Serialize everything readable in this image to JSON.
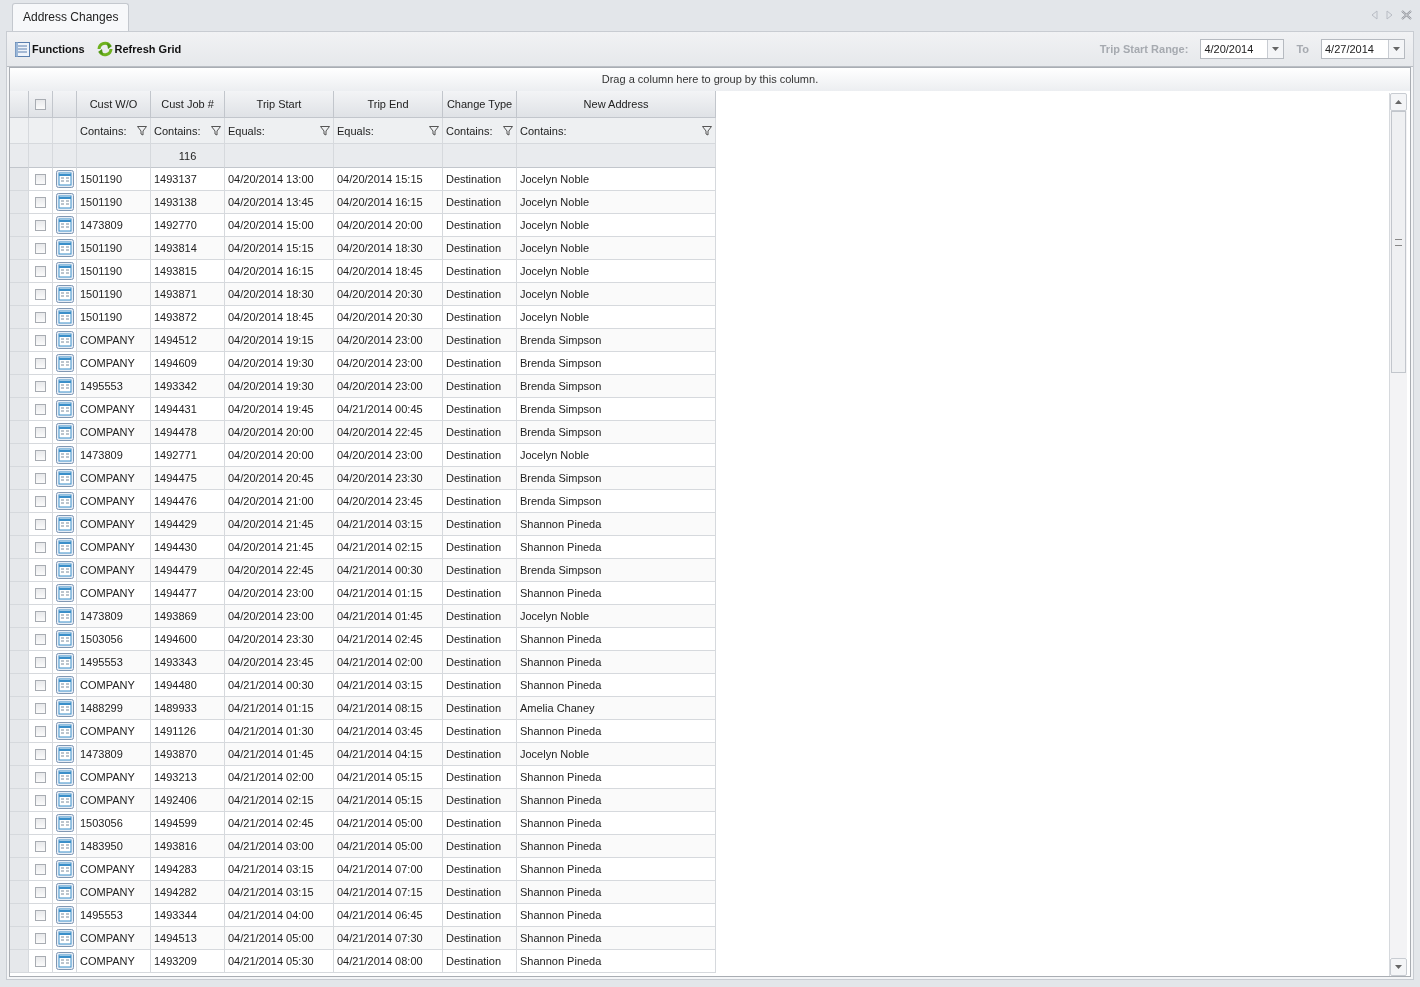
{
  "tab": {
    "label": "Address Changes",
    "selected": true
  },
  "toolbar": {
    "functions": "Functions",
    "refresh": "Refresh Grid",
    "range_label": "Trip Start Range:",
    "from": "4/20/2014",
    "to_label": "To",
    "to": "4/27/2014"
  },
  "group_panel": "Drag a column here to group by this column.",
  "grid": {
    "select_all_checked": false,
    "columns": [
      {
        "label": "Cust W/O",
        "filter": "Contains:"
      },
      {
        "label": "Cust Job #",
        "filter": "Contains:"
      },
      {
        "label": "Trip Start",
        "filter": "Equals:"
      },
      {
        "label": "Trip End",
        "filter": "Equals:"
      },
      {
        "label": "Change Type",
        "filter": "Contains:"
      },
      {
        "label": "New Address",
        "filter": "Contains:"
      }
    ],
    "summary": {
      "cust_job_count": "116"
    },
    "rows": [
      {
        "checked": false,
        "cells": [
          "1501190",
          "1493137",
          "04/20/2014 13:00",
          "04/20/2014 15:15",
          "Destination",
          "Jocelyn Noble"
        ]
      },
      {
        "checked": false,
        "cells": [
          "1501190",
          "1493138",
          "04/20/2014 13:45",
          "04/20/2014 16:15",
          "Destination",
          "Jocelyn Noble"
        ]
      },
      {
        "checked": false,
        "cells": [
          "1473809",
          "1492770",
          "04/20/2014 15:00",
          "04/20/2014 20:00",
          "Destination",
          "Jocelyn Noble"
        ]
      },
      {
        "checked": false,
        "cells": [
          "1501190",
          "1493814",
          "04/20/2014 15:15",
          "04/20/2014 18:30",
          "Destination",
          "Jocelyn Noble"
        ]
      },
      {
        "checked": false,
        "cells": [
          "1501190",
          "1493815",
          "04/20/2014 16:15",
          "04/20/2014 18:45",
          "Destination",
          "Jocelyn Noble"
        ]
      },
      {
        "checked": false,
        "cells": [
          "1501190",
          "1493871",
          "04/20/2014 18:30",
          "04/20/2014 20:30",
          "Destination",
          "Jocelyn Noble"
        ]
      },
      {
        "checked": false,
        "cells": [
          "1501190",
          "1493872",
          "04/20/2014 18:45",
          "04/20/2014 20:30",
          "Destination",
          "Jocelyn Noble"
        ]
      },
      {
        "checked": false,
        "cells": [
          "COMPANY",
          "1494512",
          "04/20/2014 19:15",
          "04/20/2014 23:00",
          "Destination",
          "Brenda Simpson"
        ]
      },
      {
        "checked": false,
        "cells": [
          "COMPANY",
          "1494609",
          "04/20/2014 19:30",
          "04/20/2014 23:00",
          "Destination",
          "Brenda Simpson"
        ]
      },
      {
        "checked": false,
        "cells": [
          "1495553",
          "1493342",
          "04/20/2014 19:30",
          "04/20/2014 23:00",
          "Destination",
          "Brenda Simpson"
        ]
      },
      {
        "checked": false,
        "cells": [
          "COMPANY",
          "1494431",
          "04/20/2014 19:45",
          "04/21/2014 00:45",
          "Destination",
          "Brenda Simpson"
        ]
      },
      {
        "checked": false,
        "cells": [
          "COMPANY",
          "1494478",
          "04/20/2014 20:00",
          "04/20/2014 22:45",
          "Destination",
          "Brenda Simpson"
        ]
      },
      {
        "checked": false,
        "cells": [
          "1473809",
          "1492771",
          "04/20/2014 20:00",
          "04/20/2014 23:00",
          "Destination",
          "Jocelyn Noble"
        ]
      },
      {
        "checked": false,
        "cells": [
          "COMPANY",
          "1494475",
          "04/20/2014 20:45",
          "04/20/2014 23:30",
          "Destination",
          "Brenda Simpson"
        ]
      },
      {
        "checked": false,
        "cells": [
          "COMPANY",
          "1494476",
          "04/20/2014 21:00",
          "04/20/2014 23:45",
          "Destination",
          "Brenda Simpson"
        ]
      },
      {
        "checked": false,
        "cells": [
          "COMPANY",
          "1494429",
          "04/20/2014 21:45",
          "04/21/2014 03:15",
          "Destination",
          "Shannon Pineda"
        ]
      },
      {
        "checked": false,
        "cells": [
          "COMPANY",
          "1494430",
          "04/20/2014 21:45",
          "04/21/2014 02:15",
          "Destination",
          "Shannon Pineda"
        ]
      },
      {
        "checked": false,
        "cells": [
          "COMPANY",
          "1494479",
          "04/20/2014 22:45",
          "04/21/2014 00:30",
          "Destination",
          "Brenda Simpson"
        ]
      },
      {
        "checked": false,
        "cells": [
          "COMPANY",
          "1494477",
          "04/20/2014 23:00",
          "04/21/2014 01:15",
          "Destination",
          "Shannon Pineda"
        ]
      },
      {
        "checked": false,
        "cells": [
          "1473809",
          "1493869",
          "04/20/2014 23:00",
          "04/21/2014 01:45",
          "Destination",
          "Jocelyn Noble"
        ]
      },
      {
        "checked": false,
        "cells": [
          "1503056",
          "1494600",
          "04/20/2014 23:30",
          "04/21/2014 02:45",
          "Destination",
          "Shannon Pineda"
        ]
      },
      {
        "checked": false,
        "cells": [
          "1495553",
          "1493343",
          "04/20/2014 23:45",
          "04/21/2014 02:00",
          "Destination",
          "Shannon Pineda"
        ]
      },
      {
        "checked": false,
        "cells": [
          "COMPANY",
          "1494480",
          "04/21/2014 00:30",
          "04/21/2014 03:15",
          "Destination",
          "Shannon Pineda"
        ]
      },
      {
        "checked": false,
        "cells": [
          "1488299",
          "1489933",
          "04/21/2014 01:15",
          "04/21/2014 08:15",
          "Destination",
          "Amelia Chaney"
        ]
      },
      {
        "checked": false,
        "cells": [
          "COMPANY",
          "1491126",
          "04/21/2014 01:30",
          "04/21/2014 03:45",
          "Destination",
          "Shannon Pineda"
        ]
      },
      {
        "checked": false,
        "cells": [
          "1473809",
          "1493870",
          "04/21/2014 01:45",
          "04/21/2014 04:15",
          "Destination",
          "Jocelyn Noble"
        ]
      },
      {
        "checked": false,
        "cells": [
          "COMPANY",
          "1493213",
          "04/21/2014 02:00",
          "04/21/2014 05:15",
          "Destination",
          "Shannon Pineda"
        ]
      },
      {
        "checked": false,
        "cells": [
          "COMPANY",
          "1492406",
          "04/21/2014 02:15",
          "04/21/2014 05:15",
          "Destination",
          "Shannon Pineda"
        ]
      },
      {
        "checked": false,
        "cells": [
          "1503056",
          "1494599",
          "04/21/2014 02:45",
          "04/21/2014 05:00",
          "Destination",
          "Shannon Pineda"
        ]
      },
      {
        "checked": false,
        "cells": [
          "1483950",
          "1493816",
          "04/21/2014 03:00",
          "04/21/2014 05:00",
          "Destination",
          "Shannon Pineda"
        ]
      },
      {
        "checked": false,
        "cells": [
          "COMPANY",
          "1494283",
          "04/21/2014 03:15",
          "04/21/2014 07:00",
          "Destination",
          "Shannon Pineda"
        ]
      },
      {
        "checked": false,
        "cells": [
          "COMPANY",
          "1494282",
          "04/21/2014 03:15",
          "04/21/2014 07:15",
          "Destination",
          "Shannon Pineda"
        ]
      },
      {
        "checked": false,
        "cells": [
          "1495553",
          "1493344",
          "04/21/2014 04:00",
          "04/21/2014 06:45",
          "Destination",
          "Shannon Pineda"
        ]
      },
      {
        "checked": false,
        "cells": [
          "COMPANY",
          "1494513",
          "04/21/2014 05:00",
          "04/21/2014 07:30",
          "Destination",
          "Shannon Pineda"
        ]
      },
      {
        "checked": false,
        "cells": [
          "COMPANY",
          "1493209",
          "04/21/2014 05:30",
          "04/21/2014 08:00",
          "Destination",
          "Shannon Pineda"
        ]
      }
    ]
  }
}
